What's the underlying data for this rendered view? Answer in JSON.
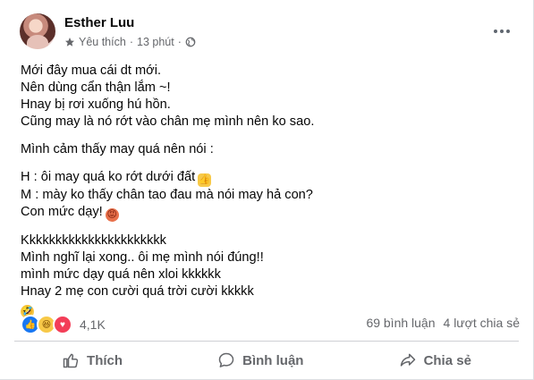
{
  "post": {
    "author": "Esther Luu",
    "favorite_label": "Yêu thích",
    "separator": "·",
    "time": "13 phút",
    "separator2": "·"
  },
  "content": {
    "p1": [
      "Mới đây mua cái dt mới.",
      "Nên dùng cẩn thận lắm ~!",
      "Hnay bị rơi xuống hú hồn.",
      "Cũng may là nó rớt vào chân mẹ mình nên ko sao."
    ],
    "p2": "Mình cảm thấy may quá nên nói :",
    "p3": [
      "H : ôi may quá ko rớt dưới đất",
      "M : mày ko thấy chân tao đau mà nói may hả con?",
      "Con mức dạy!"
    ],
    "p4": [
      "Kkkkkkkkkkkkkkkkkkkkkk",
      "Mình nghĩ lại xong.. ôi mẹ mình nói đúng!!",
      "mình mức dạy quá nên xloi kkkkkk",
      "Hnay 2 mẹ con cười quá trời cười kkkkk"
    ]
  },
  "reactions": {
    "count": "4,1K",
    "types": [
      "like-icon",
      "haha-icon",
      "love-icon"
    ]
  },
  "stats": {
    "comments": "69 bình luận",
    "shares": "4 lượt chia sẻ"
  },
  "actions": {
    "like": "Thích",
    "comment": "Bình luận",
    "share": "Chia sẻ"
  },
  "colors": {
    "secondary_text": "#65676b",
    "like_blue": "#1877f2",
    "love_red": "#f33e58",
    "haha_yellow": "#f7c948"
  }
}
